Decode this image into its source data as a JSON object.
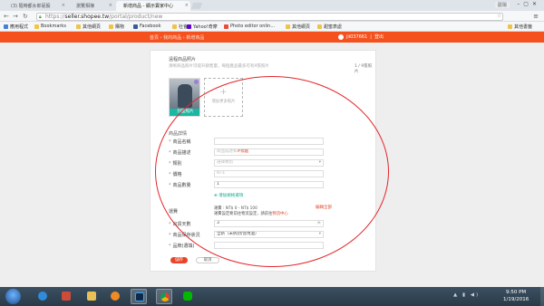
{
  "browser": {
    "tabs": [
      {
        "label": "(3) 隨時都女郎屁股"
      },
      {
        "label": "瀏覽相簿"
      },
      {
        "label": "新增商品 - 顯示賣家中心"
      }
    ],
    "profile": "歐陽",
    "url": {
      "scheme": "https://",
      "host": "seller.shopee.tw",
      "path": "/portal/product/new"
    },
    "bookmarks": [
      {
        "label": "應用程式",
        "icon_color": "#4a7fd6"
      },
      {
        "label": "Bookmarks",
        "icon_color": "#f5c542"
      },
      {
        "label": "其他網頁",
        "icon_color": "#f0c24b"
      },
      {
        "label": "購物",
        "icon_color": "#f0c24b"
      },
      {
        "label": "Facebook",
        "icon_color": "#3b5998"
      },
      {
        "label": "社會",
        "icon_color": "#f0c24b"
      },
      {
        "label": "Yahoo!奇摩",
        "icon_color": "#5f01d1"
      },
      {
        "label": "Photo editor onlin...",
        "icon_color": "#e74c3c"
      },
      {
        "label": "其他網頁",
        "icon_color": "#f0c24b"
      },
      {
        "label": "甜蜜表處",
        "icon_color": "#f0c24b"
      },
      {
        "label": "其他書籤",
        "icon_color": "#f0c24b"
      }
    ]
  },
  "header": {
    "breadcrumb": "首頁 › 我的商品 › 新增商品",
    "username": "jii037661",
    "logout": "登出"
  },
  "form": {
    "images_section": {
      "title": "遠程商品照片",
      "hint": "清晰商品照片可提升銷售量，每個產品最多可有9張照片",
      "counter": "1 / 9張照片",
      "cover_label": "封面照片",
      "add_label": "增加更多照片"
    },
    "details_title": "商品詳情",
    "fields": [
      {
        "label": "商品名稱",
        "value": ""
      },
      {
        "label": "商品描述",
        "value": "商品描述和#標籤",
        "highlight": "#標籤"
      },
      {
        "label": "類別",
        "value": "選擇類別",
        "dropdown": true
      },
      {
        "label": "價格",
        "value": "NT$"
      },
      {
        "label": "商品數量",
        "value": "1",
        "filled": true
      }
    ],
    "add_variation": "⊕ 增加規格選項",
    "shipping": {
      "label": "運費",
      "line1": "運費 : NT$ 0 - NT$ 100",
      "line2_prefix": "運費設定要前往物流設定，請前往",
      "line2_link": "物流中心",
      "edit_all": "編輯全部"
    },
    "extra_fields": [
      {
        "label": "出貨天數",
        "value": "3",
        "suffix": "天"
      },
      {
        "label": "商品保存狀況",
        "value": "全新（未拆封/含用過）",
        "dropdown": true
      },
      {
        "label": "品牌(選填)",
        "value": ""
      }
    ],
    "save_label": "儲存",
    "cancel_label": "取消"
  },
  "taskbar": {
    "time": "9:50 PM",
    "date": "1/19/2016"
  }
}
